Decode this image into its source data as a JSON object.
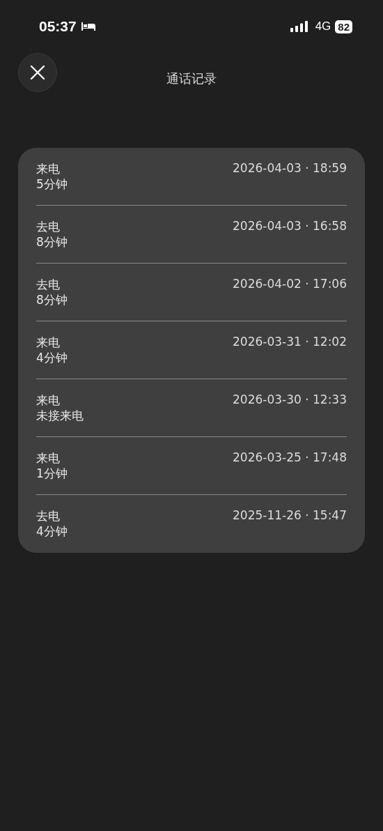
{
  "status_bar": {
    "time": "05:37",
    "network": "4G",
    "battery": "82"
  },
  "header": {
    "title": "通话记录"
  },
  "calls": [
    {
      "direction": "来电",
      "duration": "5分钟",
      "datetime": "2026-04-03 · 18:59"
    },
    {
      "direction": "去电",
      "duration": "8分钟",
      "datetime": "2026-04-03 · 16:58"
    },
    {
      "direction": "去电",
      "duration": "8分钟",
      "datetime": "2026-04-02 · 17:06"
    },
    {
      "direction": "来电",
      "duration": "4分钟",
      "datetime": "2026-03-31 · 12:02"
    },
    {
      "direction": "来电",
      "duration": "未接来电",
      "datetime": "2026-03-30 · 12:33"
    },
    {
      "direction": "来电",
      "duration": "1分钟",
      "datetime": "2026-03-25 · 17:48"
    },
    {
      "direction": "去电",
      "duration": "4分钟",
      "datetime": "2025-11-26 · 15:47"
    }
  ]
}
